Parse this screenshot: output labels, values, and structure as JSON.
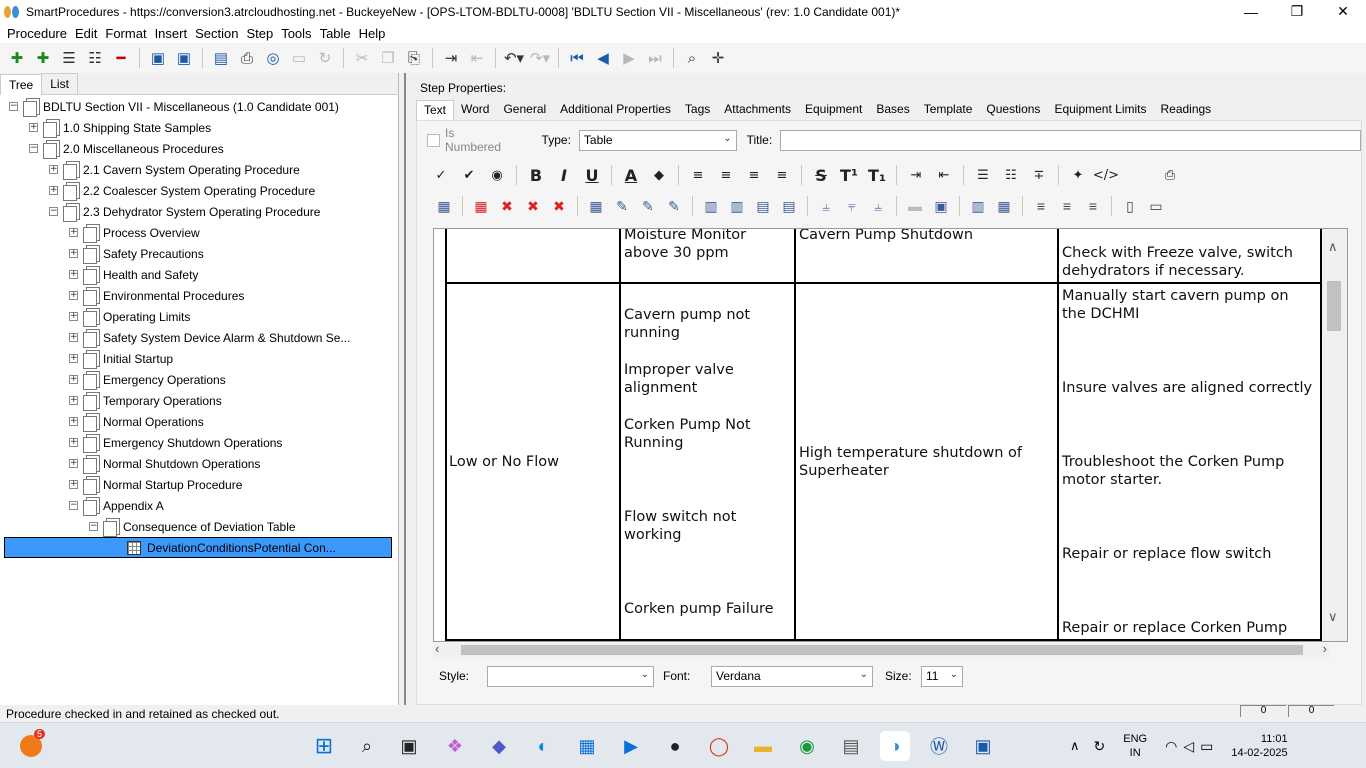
{
  "window": {
    "title": "SmartProcedures - https://conversion3.atrcloudhosting.net - BuckeyeNew - [OPS-LTOM-BDLTU-0008] 'BDLTU Section VII - Miscellaneous' (rev: 1.0 Candidate 001)*"
  },
  "menu": [
    "Procedure",
    "Edit",
    "Format",
    "Insert",
    "Section",
    "Step",
    "Tools",
    "Table",
    "Help"
  ],
  "left_tabs": [
    "Tree",
    "List"
  ],
  "tree": [
    {
      "label": "BDLTU Section VII - Miscellaneous (1.0 Candidate 001)",
      "level": 0,
      "exp": "−"
    },
    {
      "label": "1.0 Shipping State Samples",
      "level": 1,
      "exp": "+"
    },
    {
      "label": "2.0 Miscellaneous Procedures",
      "level": 1,
      "exp": "−"
    },
    {
      "label": "2.1 Cavern System Operating Procedure",
      "level": 2,
      "exp": "+"
    },
    {
      "label": "2.2 Coalescer System Operating Procedure",
      "level": 2,
      "exp": "+"
    },
    {
      "label": "2.3 Dehydrator System Operating Procedure",
      "level": 2,
      "exp": "−"
    },
    {
      "label": "Process Overview",
      "level": 3,
      "exp": "+"
    },
    {
      "label": "Safety Precautions",
      "level": 3,
      "exp": "+"
    },
    {
      "label": "Health and Safety",
      "level": 3,
      "exp": "+"
    },
    {
      "label": "Environmental Procedures",
      "level": 3,
      "exp": "+"
    },
    {
      "label": "Operating Limits",
      "level": 3,
      "exp": "+"
    },
    {
      "label": "Safety System Device Alarm & Shutdown Se...",
      "level": 3,
      "exp": "+"
    },
    {
      "label": "Initial Startup",
      "level": 3,
      "exp": "+"
    },
    {
      "label": "Emergency Operations",
      "level": 3,
      "exp": "+"
    },
    {
      "label": "Temporary Operations",
      "level": 3,
      "exp": "+"
    },
    {
      "label": "Normal Operations",
      "level": 3,
      "exp": "+"
    },
    {
      "label": "Emergency Shutdown Operations",
      "level": 3,
      "exp": "+"
    },
    {
      "label": "Normal Shutdown Operations",
      "level": 3,
      "exp": "+"
    },
    {
      "label": "Normal Startup Procedure",
      "level": 3,
      "exp": "+"
    },
    {
      "label": "Appendix A",
      "level": 3,
      "exp": "−"
    },
    {
      "label": "Consequence of Deviation Table",
      "level": 4,
      "exp": "−"
    },
    {
      "label": "DeviationConditionsPotential Con...",
      "level": 5,
      "exp": "",
      "selected": true
    }
  ],
  "step_properties": {
    "heading": "Step Properties:",
    "tabs": [
      "Text",
      "Word",
      "General",
      "Additional Properties",
      "Tags",
      "Attachments",
      "Equipment",
      "Bases",
      "Template",
      "Questions",
      "Equipment Limits",
      "Readings"
    ],
    "is_numbered": "Is Numbered",
    "type_label": "Type:",
    "type_value": "Table",
    "title_label": "Title:",
    "title_value": ""
  },
  "table_cells": {
    "r0c1": "Moisture Monitor\nabove 30 ppm",
    "r0c2": "Cavern Pump Shutdown",
    "r0c3": "Check with Freeze valve, switch\ndehydrators if necessary.",
    "r1c0": "Low or No Flow",
    "r1c1a": "Cavern pump not\nrunning",
    "r1c1b": "Improper valve\nalignment",
    "r1c1c": "Corken Pump Not\nRunning",
    "r1c1d": "Flow switch not\nworking",
    "r1c1e": "Corken pump Failure",
    "r1c2": "High temperature shutdown of\nSuperheater",
    "r1c3a": "Manually start cavern pump on\nthe DCHMI",
    "r1c3b": "Insure valves are aligned correctly",
    "r1c3c": "Troubleshoot the Corken Pump\nmotor starter.",
    "r1c3d": "Repair or replace flow switch",
    "r1c3e": "Repair or replace Corken Pump"
  },
  "bottom": {
    "style_label": "Style:",
    "style_value": "",
    "font_label": "Font:",
    "font_value": "Verdana",
    "size_label": "Size:",
    "size_value": "11"
  },
  "status": {
    "text": "Procedure checked in and retained as checked out.",
    "box1": "0",
    "box2": "0"
  },
  "taskbar": {
    "badge": "5",
    "lang1": "ENG",
    "lang2": "IN",
    "time": "11:01",
    "date": "14-02-2025"
  }
}
